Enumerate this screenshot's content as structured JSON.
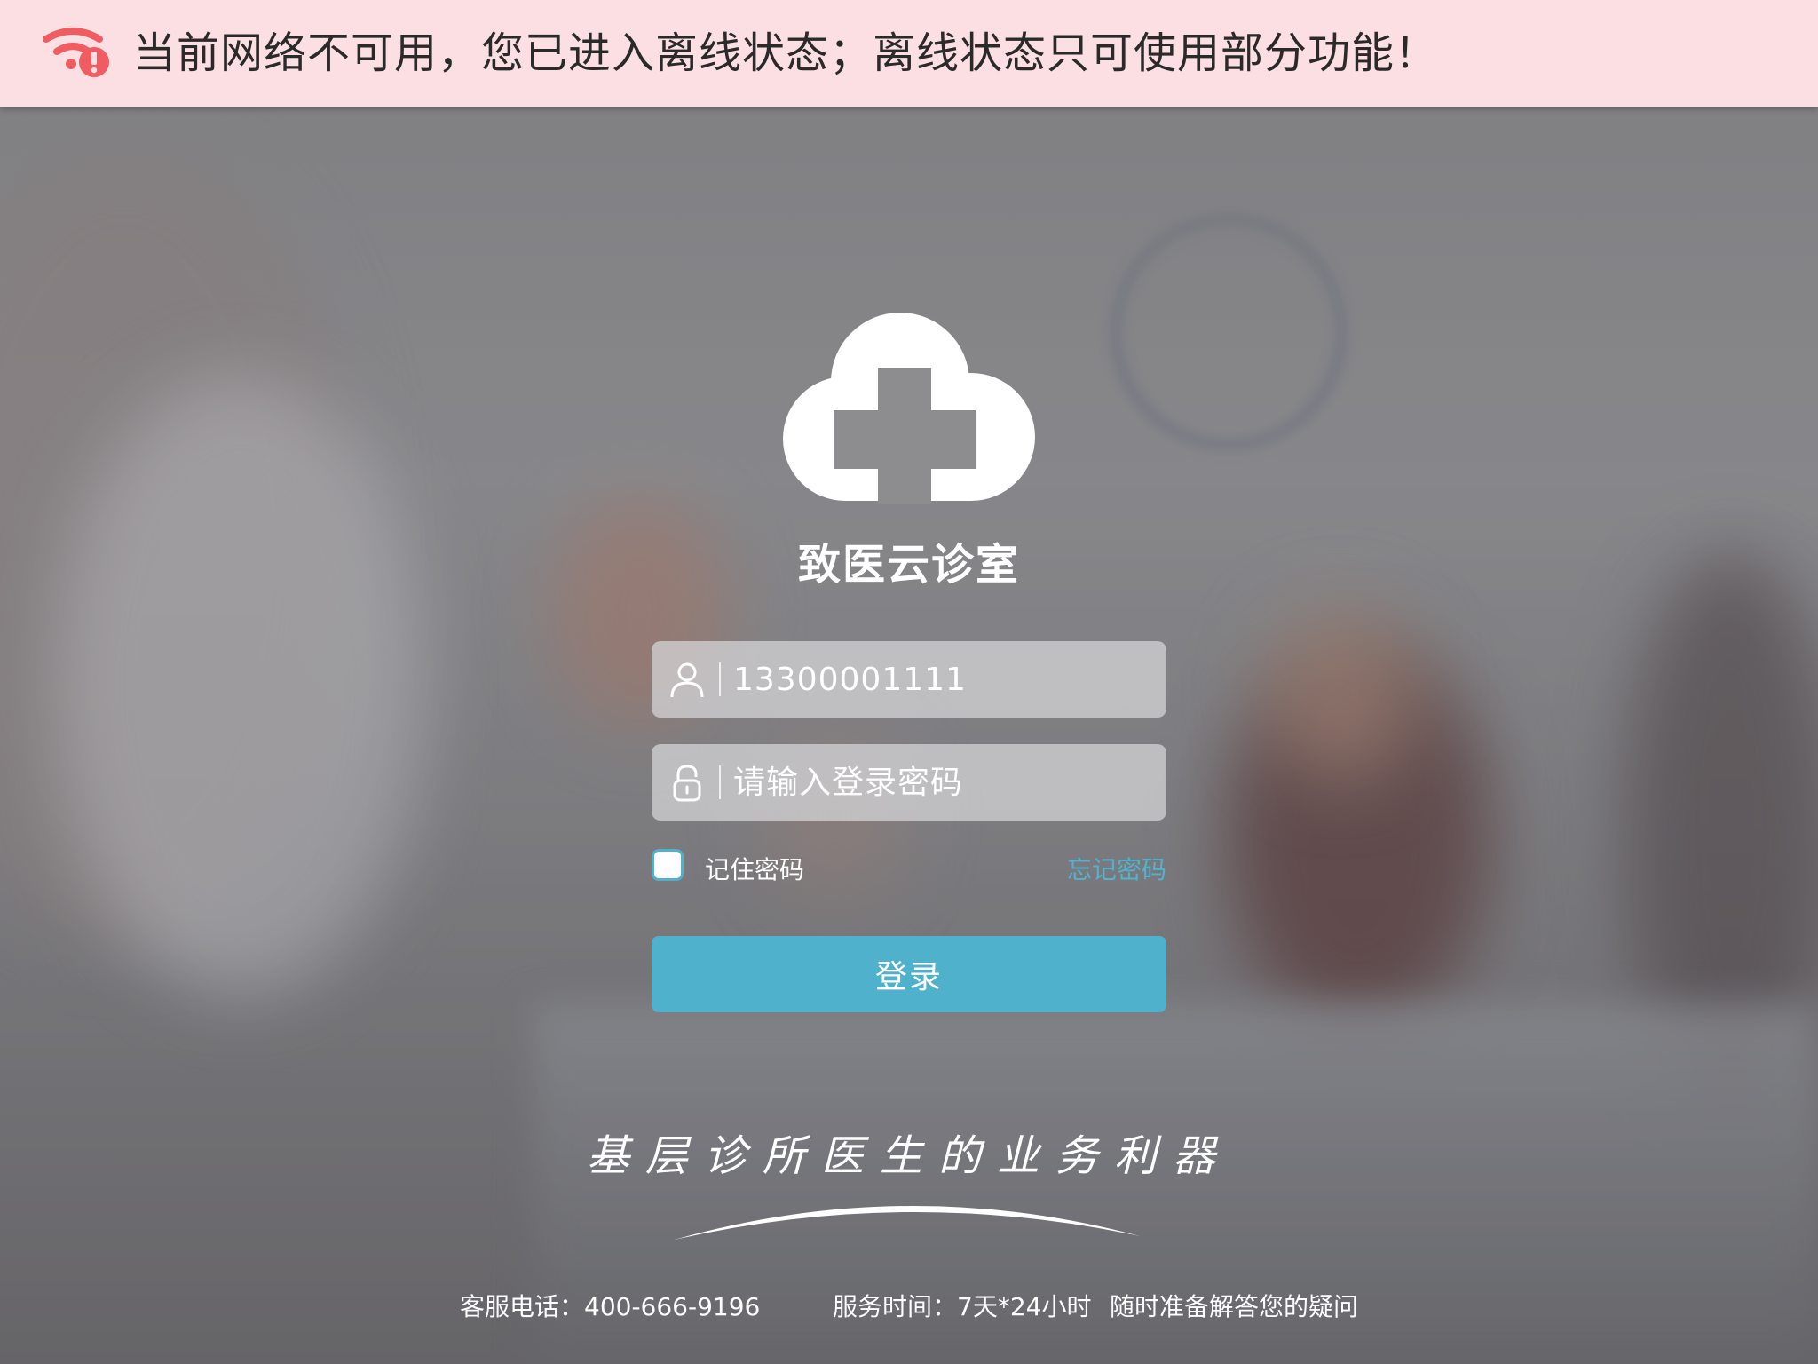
{
  "banner": {
    "icon": "wifi-offline-warning-icon",
    "message": "当前网络不可用，您已进入离线状态；离线状态只可使用部分功能！",
    "background": "#fcdfe2",
    "icon_color": "#ef5d62"
  },
  "app": {
    "logo_icon": "cloud-cross-logo",
    "name": "致医云诊室"
  },
  "login_form": {
    "username": {
      "icon": "user-icon",
      "value": "13300001111",
      "placeholder": ""
    },
    "password": {
      "icon": "lock-icon",
      "value": "",
      "placeholder": "请输入登录密码"
    },
    "remember": {
      "label": "记住密码",
      "checked": false
    },
    "forgot_link": "忘记密码",
    "submit_label": "登录",
    "accent_color": "#4fb1cc"
  },
  "slogan": "基层诊所医生的业务利器",
  "footer": {
    "phone": "客服电话：400-666-9196",
    "hours": "服务时间：7天*24小时",
    "ready": "随时准备解答您的疑问"
  }
}
